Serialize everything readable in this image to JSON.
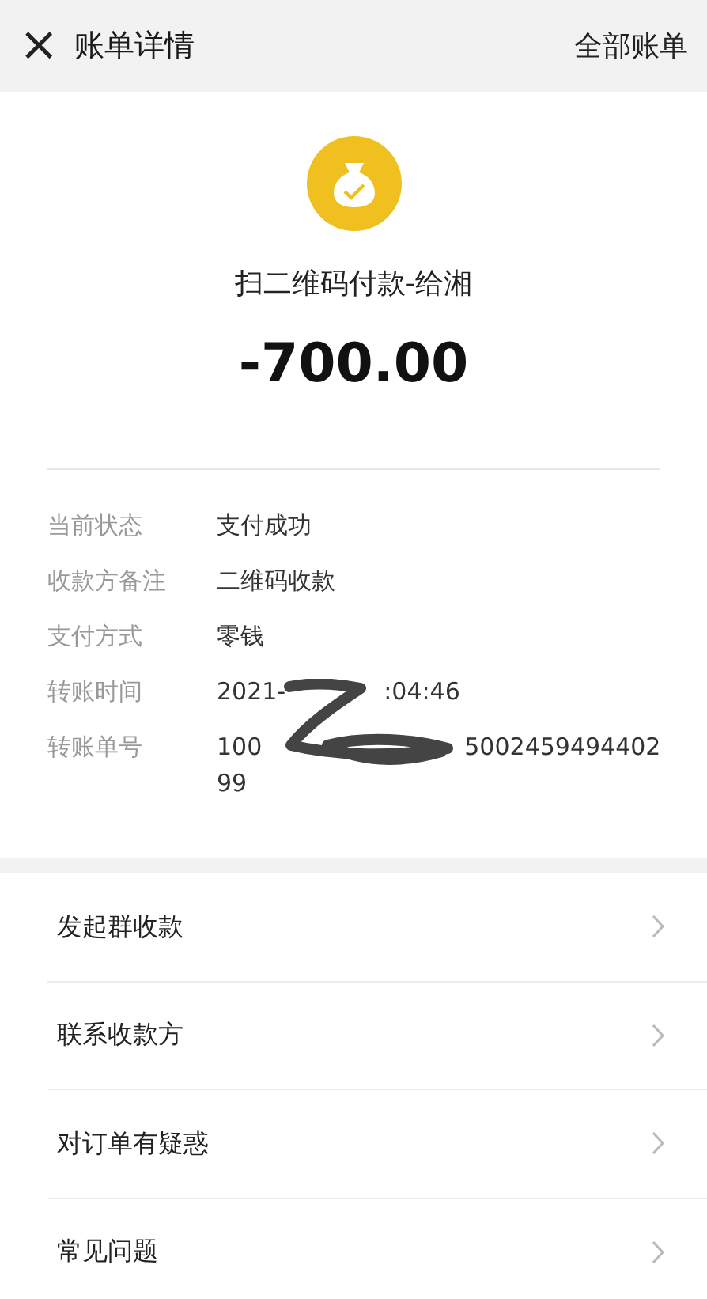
{
  "header": {
    "close": "×",
    "title": "账单详情",
    "action": "全部账单"
  },
  "summary": {
    "title": "扫二维码付款-给湘",
    "amount": "-700.00"
  },
  "details": [
    {
      "label": "当前状态",
      "lines": [
        [
          "支付成功"
        ]
      ]
    },
    {
      "label": "收款方备注",
      "lines": [
        [
          "二维码收款"
        ]
      ]
    },
    {
      "label": "支付方式",
      "lines": [
        [
          "零钱"
        ]
      ]
    },
    {
      "label": "转账时间",
      "lines": [
        [
          "2021-",
          ":04:46"
        ]
      ]
    },
    {
      "label": "转账单号",
      "lines": [
        [
          "100",
          "5002459494402"
        ],
        [
          "99"
        ]
      ]
    }
  ],
  "menu": [
    {
      "label": "发起群收款"
    },
    {
      "label": "联系收款方"
    },
    {
      "label": "对订单有疑惑"
    },
    {
      "label": "常见问题"
    }
  ]
}
